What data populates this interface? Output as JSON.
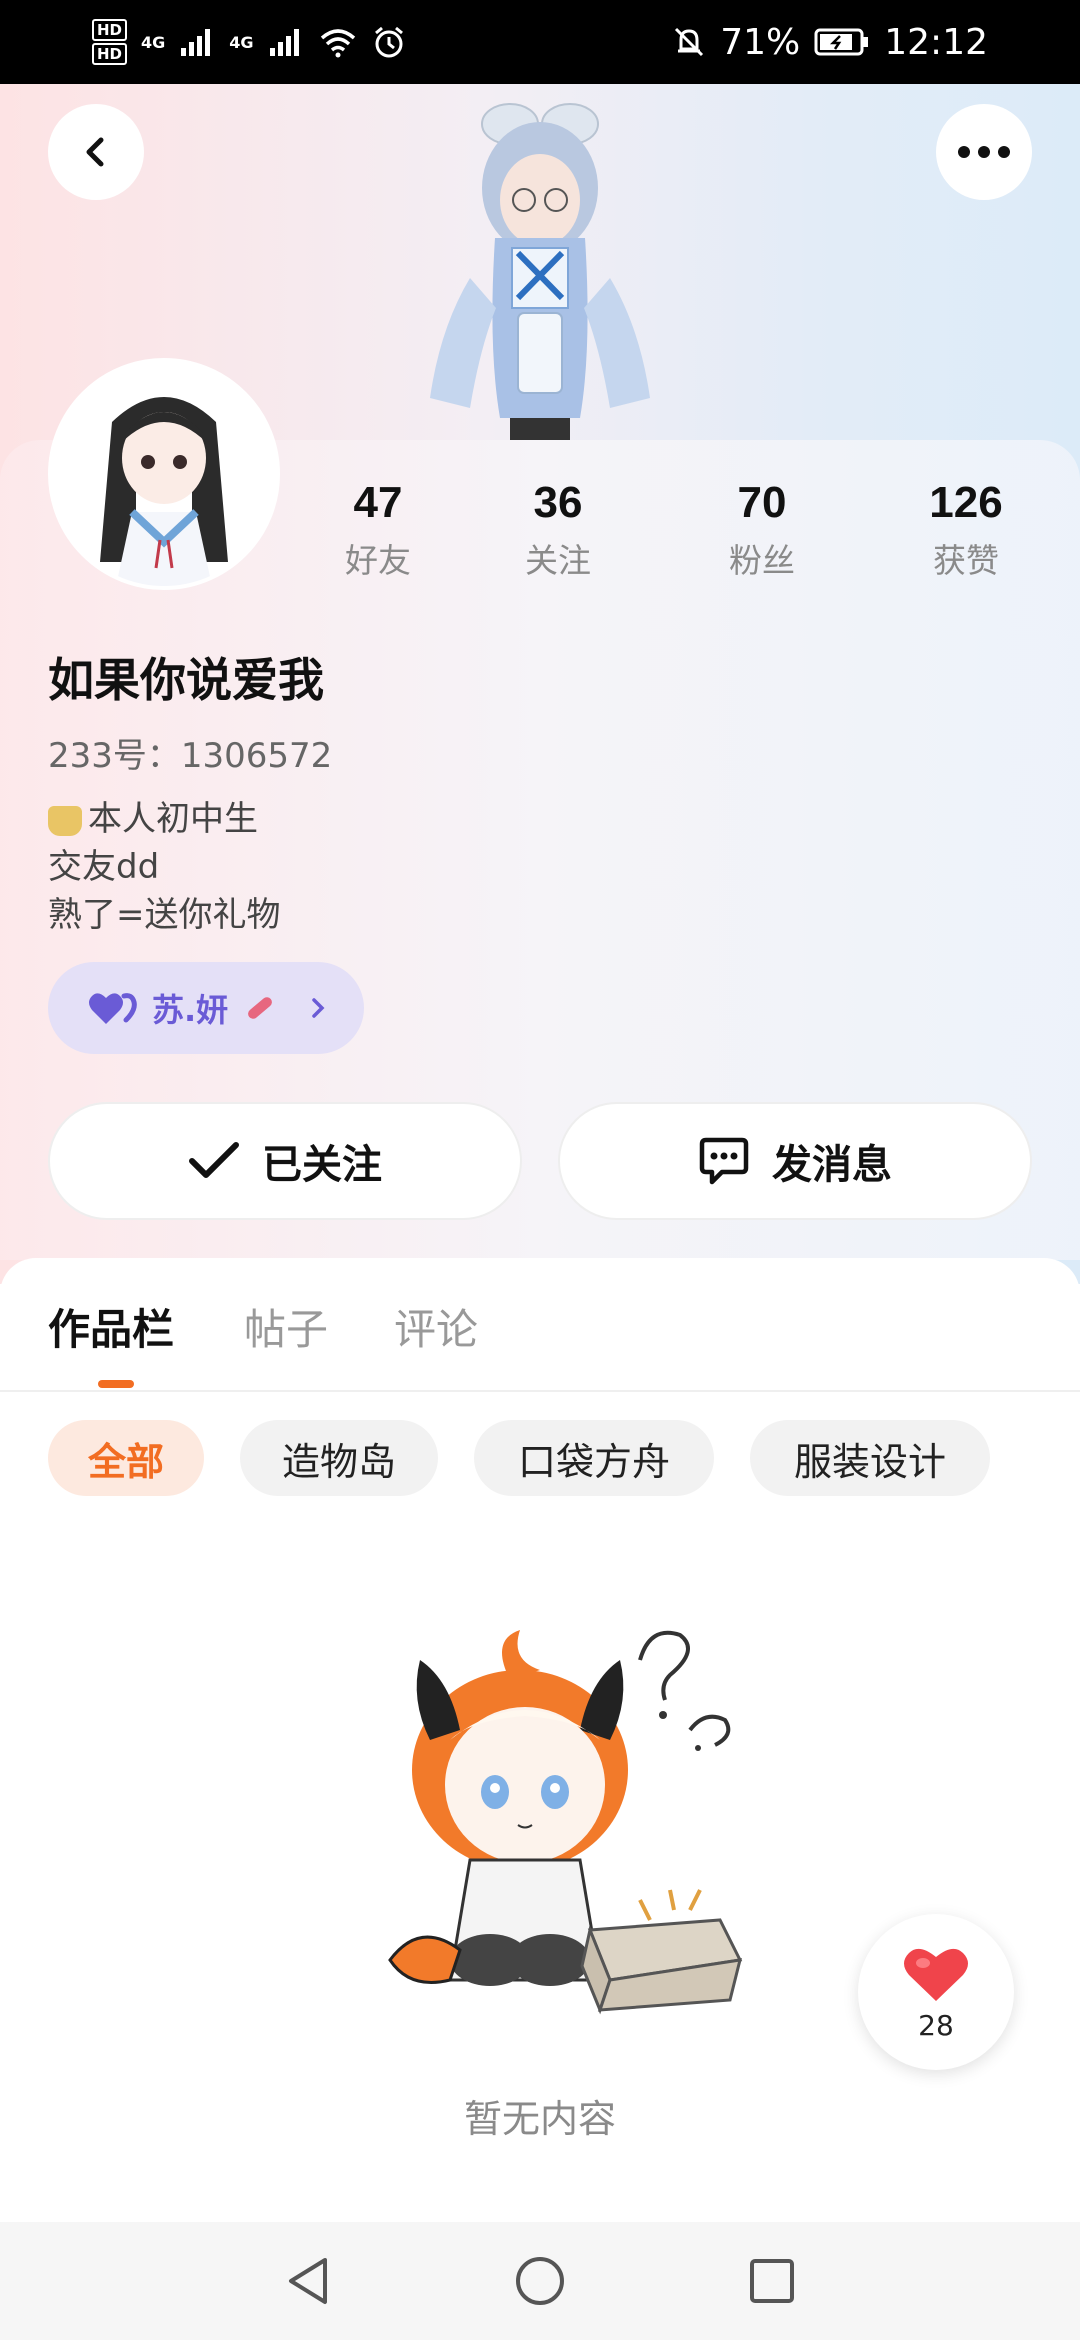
{
  "status_bar": {
    "hd1": "HD",
    "hd2": "HD",
    "network1": "4G",
    "network2": "4G",
    "battery": "71%",
    "time": "12:12"
  },
  "profile": {
    "username": "如果你说爱我",
    "uid": "233号：1306572",
    "bio": [
      "本人初中生",
      "交友dd",
      "熟了=送你礼物"
    ],
    "cp_name": "苏.妍",
    "stats": [
      {
        "value": "47",
        "label": "好友"
      },
      {
        "value": "36",
        "label": "关注"
      },
      {
        "value": "70",
        "label": "粉丝"
      },
      {
        "value": "126",
        "label": "获赞"
      }
    ]
  },
  "actions": {
    "follow_label": "已关注",
    "message_label": "发消息"
  },
  "tabs": [
    "作品栏",
    "帖子",
    "评论"
  ],
  "filters": [
    "全部",
    "造物岛",
    "口袋方舟",
    "服装设计"
  ],
  "empty": {
    "text": "暂无内容"
  },
  "like": {
    "count": "28"
  },
  "colors": {
    "accent": "#f26d22",
    "cp_pill": "#e4e0f7",
    "cp_text": "#6a5bd6",
    "heart": "#f0444b"
  }
}
